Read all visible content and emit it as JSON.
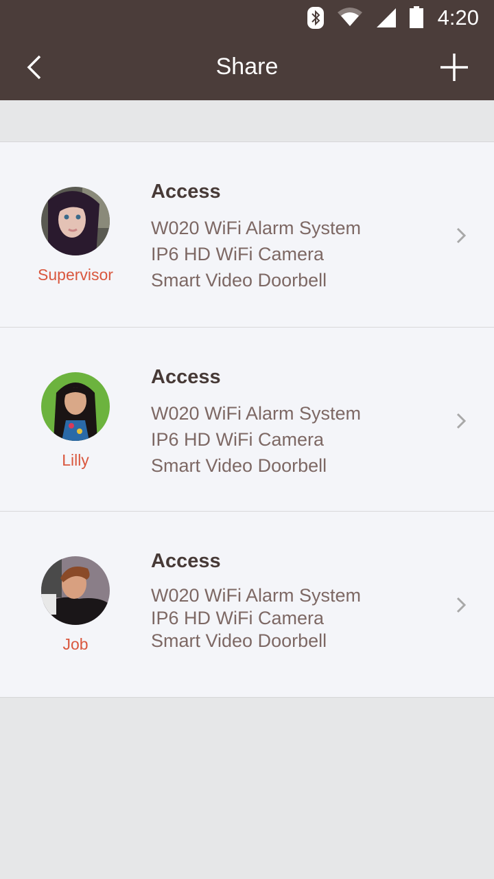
{
  "status_bar": {
    "time": "4:20",
    "icons": [
      "bluetooth-icon",
      "wifi-icon",
      "cell-signal-icon",
      "battery-icon"
    ]
  },
  "app_bar": {
    "title": "Share",
    "back_icon": "chevron-left-icon",
    "add_icon": "plus-icon"
  },
  "colors": {
    "header_bg": "#4b3d3a",
    "role_text": "#d9573e",
    "access_title": "#473a37",
    "device_text": "#7d6864",
    "list_bg": "#f4f5f9",
    "page_bg": "#e6e7e8"
  },
  "shares": [
    {
      "role": "Supervisor",
      "access_label": "Access",
      "devices": [
        "W020 WiFi Alarm System",
        "IP6 HD WiFi Camera",
        "Smart Video Doorbell"
      ]
    },
    {
      "role": "Lilly",
      "access_label": "Access",
      "devices": [
        "W020 WiFi Alarm System",
        "IP6 HD WiFi Camera",
        "Smart Video Doorbell"
      ]
    },
    {
      "role": "Job",
      "access_label": "Access",
      "devices": [
        "W020 WiFi Alarm System",
        "IP6 HD WiFi Camera",
        "Smart Video Doorbell"
      ]
    }
  ]
}
